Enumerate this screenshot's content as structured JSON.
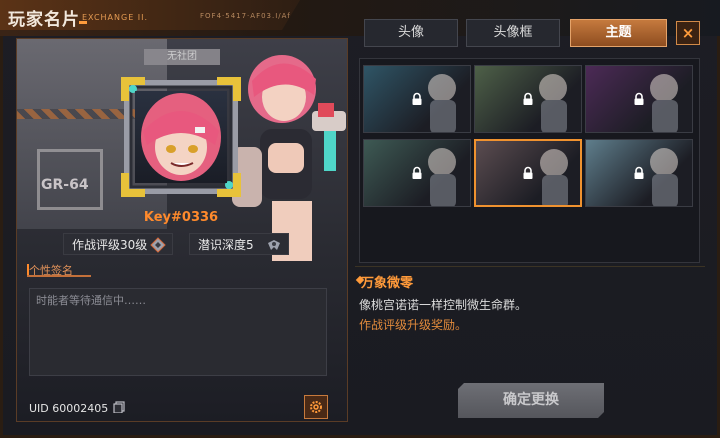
{
  "header": {
    "title": "玩家名片",
    "subtitle": "EXCHANGE II.",
    "code": "FOF4·5417·AF03.I/Af"
  },
  "profile": {
    "club": "无社团",
    "player_name": "Key#0336",
    "combat_rank": "作战评级30级",
    "dive_depth": "潜识深度5",
    "signature_label": "个性签名",
    "signature_placeholder": "时能者等待通信中……",
    "uid": "UID 60002405",
    "background_text": "GR-64"
  },
  "tabs": [
    {
      "label": "头像"
    },
    {
      "label": "头像框"
    },
    {
      "label": "主题"
    }
  ],
  "themes": [
    {
      "name": "theme-1",
      "locked": true,
      "color": "#2f5566"
    },
    {
      "name": "theme-2",
      "locked": true,
      "color": "#4e6048"
    },
    {
      "name": "theme-3",
      "locked": true,
      "color": "#4c2a56"
    },
    {
      "name": "theme-4",
      "locked": true,
      "color": "#3e5a54"
    },
    {
      "name": "theme-5",
      "locked": true,
      "color": "#5b4c50",
      "selected": true
    },
    {
      "name": "theme-6",
      "locked": true,
      "color": "#5f7e8c"
    }
  ],
  "selected_theme": {
    "name": "万象微零",
    "description": "像桃宫诺诺一样控制微生命群。",
    "condition": "作战评级升级奖励。"
  },
  "confirm_label": "确定更换",
  "close_icon": "×",
  "colors": {
    "accent": "#ff9a3a",
    "name": "#ff8a2c"
  }
}
